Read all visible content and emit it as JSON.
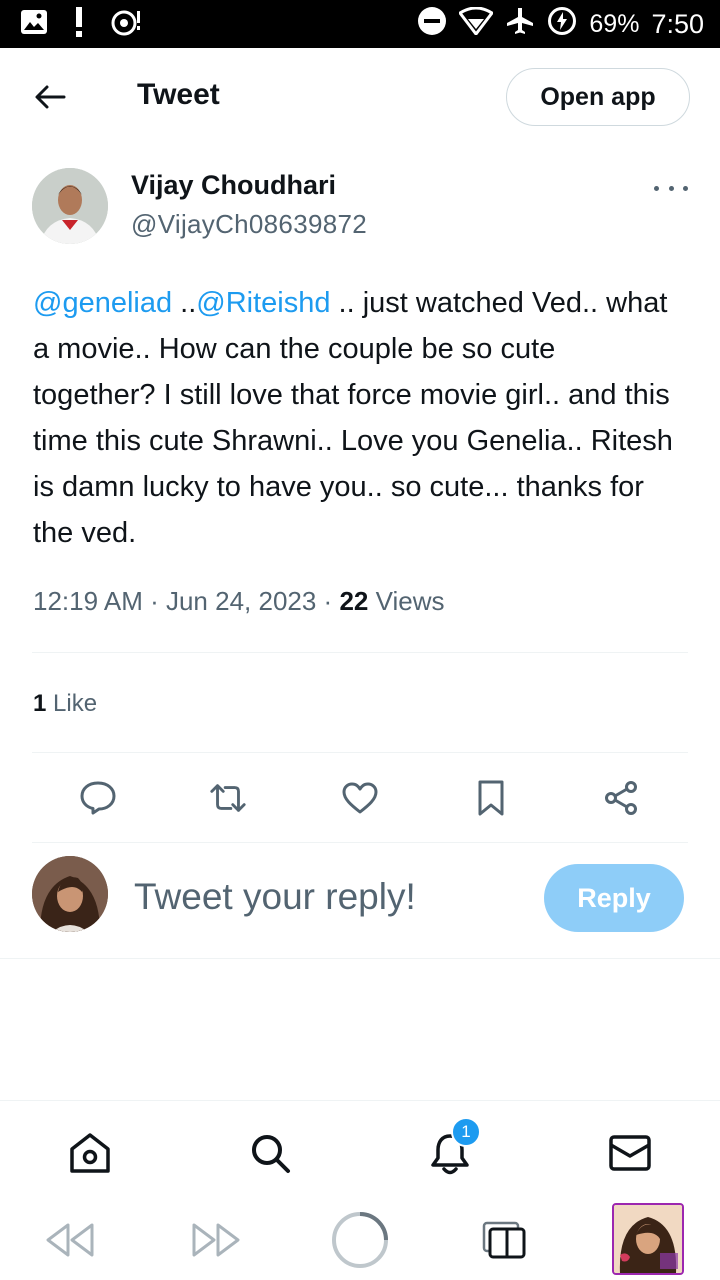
{
  "status_bar": {
    "battery": "69%",
    "time": "7:50",
    "icons": [
      "gallery-icon",
      "alert-icon",
      "sync-icon",
      "dnd-icon",
      "wifi-icon",
      "airplane-icon",
      "battery-charging-icon"
    ]
  },
  "header": {
    "title": "Tweet",
    "open_app_label": "Open app"
  },
  "tweet": {
    "author_name": "Vijay Choudhari",
    "author_handle": "@VijayCh08639872",
    "mention_1": "@geneliad",
    "sep_1": " ..",
    "mention_2": "@Riteishd",
    "body": " .. just watched Ved.. what a movie.. How can the couple be so cute together? I still love that force movie girl.. and this time this cute Shrawni.. Love you Genelia.. Ritesh is damn lucky to have you.. so cute... thanks for the ved.",
    "time": "12:19 AM",
    "date": "Jun 24, 2023",
    "views_count": "22",
    "views_label": "Views",
    "likes_count": "1",
    "likes_label": "Like"
  },
  "reply": {
    "placeholder": "Tweet your reply!",
    "button_label": "Reply"
  },
  "bottom_nav": {
    "notifications_badge": "1"
  },
  "colors": {
    "accent": "#1d9bf0",
    "reply_button_disabled": "#8ecdf8",
    "text_secondary": "#536471",
    "divider": "#eff3f4"
  }
}
